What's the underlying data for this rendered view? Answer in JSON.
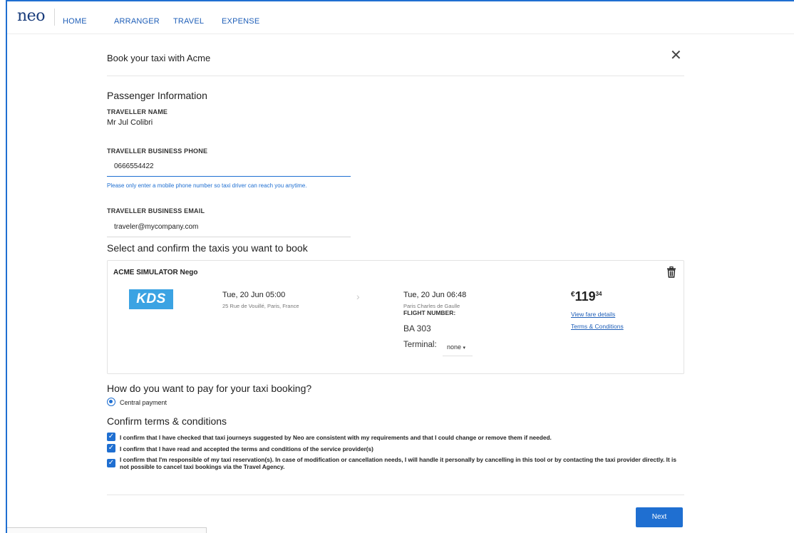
{
  "nav": {
    "logo": "neo",
    "links": [
      "HOME",
      "ARRANGER",
      "TRAVEL",
      "EXPENSE"
    ]
  },
  "dialog": {
    "title": "Book your taxi with Acme",
    "close_icon": "close-icon"
  },
  "passenger": {
    "section_title": "Passenger Information",
    "name_label": "TRAVELLER NAME",
    "name_value": "Mr Jul Colibri",
    "phone_label": "TRAVELLER BUSINESS PHONE",
    "phone_value": "0666554422",
    "phone_hint": "Please only enter a mobile phone number so taxi driver can reach you anytime.",
    "email_label": "TRAVELLER BUSINESS EMAIL",
    "email_value": "traveler@mycompany.com"
  },
  "taxis": {
    "section_title": "Select and confirm the taxis you want to book",
    "card": {
      "provider": "ACME SIMULATOR Nego",
      "logo_text": "KDS",
      "departure_date": "Tue, 20 Jun 05:00",
      "departure_address": "25 Rue de Vouillé, Paris, France",
      "arrival_date": "Tue, 20 Jun 06:48",
      "arrival_place": "Paris Charles de Gaulle",
      "flight_label": "FLIGHT NUMBER:",
      "flight_number": "BA 303",
      "terminal_label": "Terminal:",
      "terminal_value": "none",
      "price_currency": "€",
      "price_main": "119",
      "price_cents": "34",
      "fare_link": "View fare details",
      "terms_link": "Terms & Conditions"
    }
  },
  "payment": {
    "section_title": "How do you want to pay for your taxi booking?",
    "option": "Central payment"
  },
  "terms": {
    "section_title": "Confirm terms & conditions",
    "items": [
      "I confirm that I have checked that taxi journeys suggested by Neo are consistent with my requirements and that I could change or remove them if needed.",
      "I confirm that I have read and accepted the terms and conditions of the service provider(s)",
      "I confirm that I'm responsible of my taxi reservation(s). In case of modification or cancellation needs, I will handle it personally by cancelling in this tool or by contacting the taxi provider directly. It is not possible to cancel taxi bookings via the Travel Agency."
    ]
  },
  "actions": {
    "next_label": "Next"
  },
  "colors": {
    "accent": "#1f6fd1",
    "logo": "#1a3d7c",
    "kds_logo": "#3ba3e3"
  }
}
